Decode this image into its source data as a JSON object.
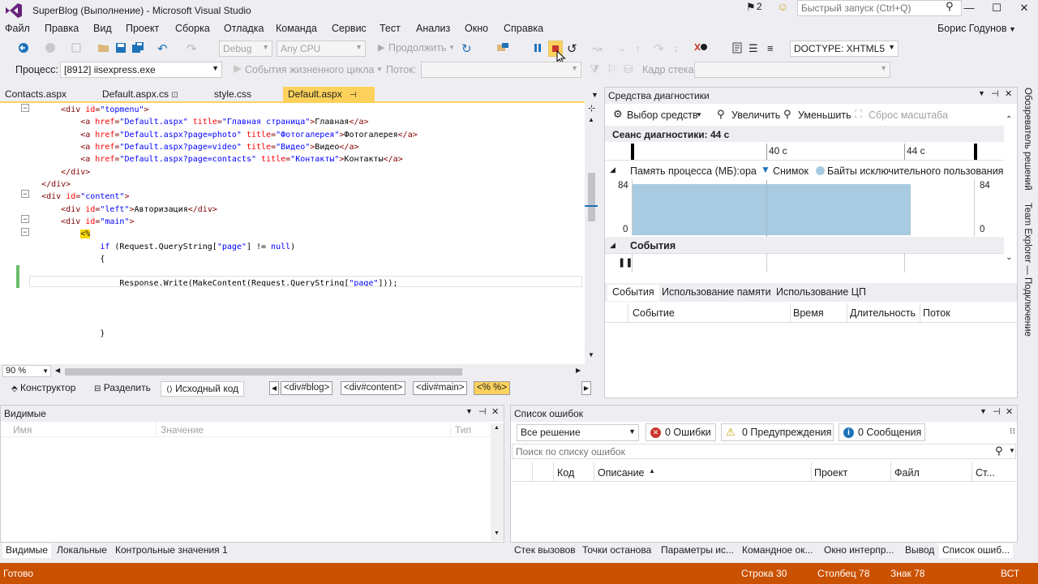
{
  "window": {
    "title": "SuperBlog (Выполнение) - Microsoft Visual Studio",
    "flag_count": "2",
    "quick_launch_placeholder": "Быстрый запуск (Ctrl+Q)",
    "min": "—",
    "max": "☐",
    "close": "✕"
  },
  "menu": [
    "Файл",
    "Правка",
    "Вид",
    "Проект",
    "Сборка",
    "Отладка",
    "Команда",
    "Сервис",
    "Тест",
    "Анализ",
    "Окно",
    "Справка"
  ],
  "user": "Борис Годунов",
  "toolbar": {
    "config": "Debug",
    "platform": "Any CPU",
    "continue_label": "Продолжить",
    "doctype": "DOCTYPE: XHTML5"
  },
  "toolbar2": {
    "process_label": "Процесс:",
    "process_value": "[8912] iisexpress.exe",
    "lifecycle": "События жизненного цикла",
    "thread_label": "Поток:",
    "stack_label": "Кадр стека:"
  },
  "editor": {
    "tabs": [
      {
        "label": "Contacts.aspx",
        "active": false
      },
      {
        "label": "Default.aspx.cs",
        "active": false
      },
      {
        "label": "style.css",
        "active": false
      },
      {
        "label": "Default.aspx",
        "active": true
      }
    ],
    "zoom": "90 %",
    "views": [
      "Конструктор",
      "Разделить",
      "Исходный код"
    ],
    "breadcrumbs": [
      "<div#blog>",
      "<div#content>",
      "<div#main>",
      "<% %>"
    ]
  },
  "code": [
    {
      "indent": 8,
      "parts": [
        [
          "tag",
          "<div "
        ],
        [
          "attr",
          "id"
        ],
        [
          "tag",
          "="
        ],
        [
          "str",
          "\"topmenu\""
        ],
        [
          "tag",
          ">"
        ]
      ]
    },
    {
      "indent": 12,
      "parts": [
        [
          "tag",
          "<a "
        ],
        [
          "attr",
          "href"
        ],
        [
          "tag",
          "="
        ],
        [
          "str",
          "\"Default.aspx\""
        ],
        [
          "txt",
          " "
        ],
        [
          "attr",
          "title"
        ],
        [
          "tag",
          "="
        ],
        [
          "str",
          "\"Главная страница\""
        ],
        [
          "tag",
          ">"
        ],
        [
          "txt",
          "Главная"
        ],
        [
          "tag",
          "</a>"
        ]
      ]
    },
    {
      "indent": 12,
      "parts": [
        [
          "tag",
          "<a "
        ],
        [
          "attr",
          "href"
        ],
        [
          "tag",
          "="
        ],
        [
          "str",
          "\"Default.aspx?page=photo\""
        ],
        [
          "txt",
          " "
        ],
        [
          "attr",
          "title"
        ],
        [
          "tag",
          "="
        ],
        [
          "str",
          "\"Фотогалерея\""
        ],
        [
          "tag",
          ">"
        ],
        [
          "txt",
          "Фотогалерея"
        ],
        [
          "tag",
          "</a>"
        ]
      ]
    },
    {
      "indent": 12,
      "parts": [
        [
          "tag",
          "<a "
        ],
        [
          "attr",
          "href"
        ],
        [
          "tag",
          "="
        ],
        [
          "str",
          "\"Default.aspx?page=video\""
        ],
        [
          "txt",
          " "
        ],
        [
          "attr",
          "title"
        ],
        [
          "tag",
          "="
        ],
        [
          "str",
          "\"Видео\""
        ],
        [
          "tag",
          ">"
        ],
        [
          "txt",
          "Видео"
        ],
        [
          "tag",
          "</a>"
        ]
      ]
    },
    {
      "indent": 12,
      "parts": [
        [
          "tag",
          "<a "
        ],
        [
          "attr",
          "href"
        ],
        [
          "tag",
          "="
        ],
        [
          "str",
          "\"Default.aspx?page=contacts\""
        ],
        [
          "txt",
          " "
        ],
        [
          "attr",
          "title"
        ],
        [
          "tag",
          "="
        ],
        [
          "str",
          "\"Контакты\""
        ],
        [
          "tag",
          ">"
        ],
        [
          "txt",
          "Контакты"
        ],
        [
          "tag",
          "</a>"
        ]
      ]
    },
    {
      "indent": 8,
      "parts": [
        [
          "tag",
          "</div>"
        ]
      ]
    },
    {
      "indent": 4,
      "parts": [
        [
          "tag",
          "</div>"
        ]
      ]
    },
    {
      "indent": 4,
      "parts": [
        [
          "tag",
          "<div "
        ],
        [
          "attr",
          "id"
        ],
        [
          "tag",
          "="
        ],
        [
          "str",
          "\"content\""
        ],
        [
          "tag",
          ">"
        ]
      ]
    },
    {
      "indent": 8,
      "parts": [
        [
          "tag",
          "<div "
        ],
        [
          "attr",
          "id"
        ],
        [
          "tag",
          "="
        ],
        [
          "str",
          "\"left\""
        ],
        [
          "tag",
          ">"
        ],
        [
          "txt",
          "Авторизация"
        ],
        [
          "tag",
          "</div>"
        ]
      ]
    },
    {
      "indent": 8,
      "parts": [
        [
          "tag",
          "<div "
        ],
        [
          "attr",
          "id"
        ],
        [
          "tag",
          "="
        ],
        [
          "str",
          "\"main\""
        ],
        [
          "tag",
          ">"
        ]
      ]
    },
    {
      "indent": 12,
      "parts": [
        [
          "hl",
          "<%"
        ]
      ]
    },
    {
      "indent": 16,
      "parts": [
        [
          "kw",
          "if"
        ],
        [
          "txt",
          " (Request.QueryString["
        ],
        [
          "str",
          "\"page\""
        ],
        [
          "txt",
          "] != "
        ],
        [
          "kw",
          "null"
        ],
        [
          "txt",
          ")"
        ]
      ]
    },
    {
      "indent": 16,
      "parts": [
        [
          "txt",
          "{"
        ]
      ]
    },
    {
      "indent": 0,
      "parts": []
    },
    {
      "indent": 20,
      "parts": [
        [
          "txt",
          "Response.Write(MakeContent(Request.QueryString["
        ],
        [
          "str",
          "\"page\""
        ],
        [
          "txt",
          "]));"
        ]
      ]
    },
    {
      "indent": 0,
      "parts": []
    },
    {
      "indent": 0,
      "parts": []
    },
    {
      "indent": 0,
      "parts": []
    },
    {
      "indent": 16,
      "parts": [
        [
          "txt",
          "}"
        ]
      ]
    }
  ],
  "diag": {
    "title": "Средства диагностики",
    "select_tools": "Выбор средств",
    "zoom_in": "Увеличить",
    "zoom_out": "Уменьшить",
    "reset_zoom": "Сброс масштаба",
    "session": "Сеанс диагностики: 44 с",
    "tick1": "40 с",
    "tick2": "44 с",
    "memory_title": "Память процесса (МБ):ора",
    "snapshot": "Снимок",
    "private_bytes": "Байты исключительного пользования",
    "y_max": "84",
    "y_min": "0",
    "events_title": "События",
    "tabs": [
      "События",
      "Использование памяти",
      "Использование ЦП"
    ],
    "cols": [
      "Событие",
      "Время",
      "Длительность",
      "Поток"
    ]
  },
  "side": [
    "Обозреватель решений",
    "Team Explorer — Подключение"
  ],
  "watch": {
    "title": "Видимые",
    "cols": [
      "Имя",
      "Значение",
      "Тип"
    ],
    "tabs": [
      "Видимые",
      "Локальные",
      "Контрольные значения 1"
    ]
  },
  "errors": {
    "title": "Список ошибок",
    "scope": "Все решение",
    "errors_label": "0 Ошибки",
    "warnings_label": "0 Предупреждения",
    "messages_label": "0 Сообщения",
    "search_placeholder": "Поиск по списку ошибок",
    "cols": [
      "Код",
      "Описание",
      "Проект",
      "Файл",
      "Ст..."
    ],
    "tabs": [
      "Стек вызовов",
      "Точки останова",
      "Параметры ис...",
      "Командное ок...",
      "Окно интерпр...",
      "Вывод",
      "Список ошиб..."
    ]
  },
  "status": {
    "ready": "Готово",
    "line": "Строка 30",
    "col": "Столбец 78",
    "char": "Знак 78",
    "mode": "ВСТ"
  },
  "colors": {
    "status_bar": "#ca5100",
    "active_tab": "#fdd25c"
  }
}
